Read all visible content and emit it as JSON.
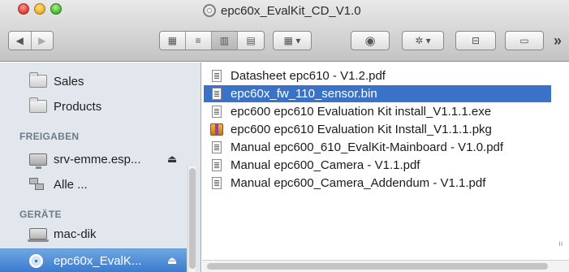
{
  "window": {
    "title": "epc60x_EvalKit_CD_V1.0",
    "title_icon": "cd-disc-icon"
  },
  "toolbar": {
    "back_glyph": "◀",
    "forward_glyph": "▶",
    "view_icons_glyph": "▦",
    "view_list_glyph": "≡",
    "view_columns_glyph": "▥",
    "view_coverflow_glyph": "▤",
    "arrange_glyph": "▦ ▾",
    "quicklook_glyph": "◉",
    "action_glyph": "✲ ▾",
    "share_glyph": "⊟",
    "new_folder_glyph": "▭",
    "overflow_glyph": "»"
  },
  "sidebar": {
    "items_top": [
      {
        "label": "Sales",
        "icon": "folder-icon"
      },
      {
        "label": "Products",
        "icon": "folder-icon"
      }
    ],
    "shared_header": "FREIGABEN",
    "shared_items": [
      {
        "label": "srv-emme.esp...",
        "icon": "monitor-icon",
        "eject": "⏏"
      },
      {
        "label": "Alle ...",
        "icon": "network-icon"
      }
    ],
    "devices_header": "GERÄTE",
    "device_items": [
      {
        "label": "mac-dik",
        "icon": "laptop-icon"
      },
      {
        "label": "epc60x_EvalK...",
        "icon": "cd-icon",
        "eject": "⏏",
        "selected": true
      }
    ]
  },
  "files": [
    {
      "name": "Datasheet epc610 - V1.2.pdf",
      "icon": "pdf-document-icon"
    },
    {
      "name": "epc60x_fw_110_sensor.bin",
      "icon": "binary-document-icon",
      "selected": true
    },
    {
      "name": "epc600 epc610 Evaluation Kit install_V1.1.1.exe",
      "icon": "blank-document-icon"
    },
    {
      "name": "epc600 epc610 Evaluation Kit Install_V1.1.1.pkg",
      "icon": "package-icon"
    },
    {
      "name": "Manual epc600_610_EvalKit-Mainboard - V1.0.pdf",
      "icon": "pdf-document-icon"
    },
    {
      "name": "Manual epc600_Camera - V1.1.pdf",
      "icon": "pdf-document-icon"
    },
    {
      "name": "Manual epc600_Camera_Addendum - V1.1.pdf",
      "icon": "pdf-document-icon"
    }
  ],
  "colors": {
    "selection": "#3a72c8",
    "sidebar_bg": "#e2e7ee",
    "sidebar_header": "#6e7a89"
  }
}
